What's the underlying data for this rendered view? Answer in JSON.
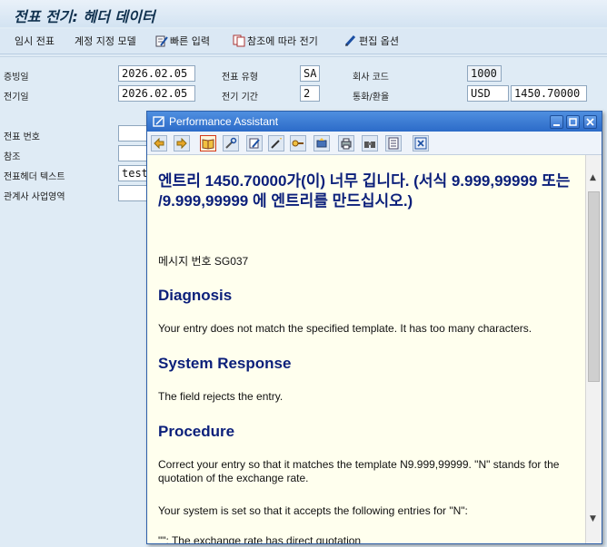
{
  "window": {
    "title": "전표 전기: 헤더 데이터"
  },
  "toolbar": {
    "items": [
      "임시 전표",
      "계정 지정 모델",
      "빠른 입력",
      "참조에 따라 전기",
      "편집 옵션"
    ]
  },
  "header_fields": {
    "doc_date_label": "증빙일",
    "doc_date_value": "2026.02.05",
    "post_date_label": "전기일",
    "post_date_value": "2026.02.05",
    "doc_type_label": "전표 유형",
    "doc_type_value": "SA",
    "period_label": "전기 기간",
    "period_value": "2",
    "company_label": "회사 코드",
    "company_value": "1000",
    "currency_label": "통화/환율",
    "currency_value": "USD",
    "rate_value": "1450.70000",
    "doc_number_label": "전표 번호",
    "reference_label": "참조",
    "header_text_label": "전표헤더 텍스트",
    "header_text_value": "test",
    "trading_partner_label": "관계사 사업영역"
  },
  "popup": {
    "title": "Performance Assistant",
    "heading": "엔트리 1450.70000가(이) 너무 깁니다. (서식 9.999,99999 또는 /9.999,99999 에 엔트리를 만드십시오.)",
    "message_number": "메시지 번호 SG037",
    "diagnosis_title": "Diagnosis",
    "diagnosis_text": "Your entry does not match the specified template. It has too many characters.",
    "response_title": "System Response",
    "response_text": "The field rejects the entry.",
    "procedure_title": "Procedure",
    "procedure_text1": "Correct your entry so that it matches the template N9.999,99999. \"N\" stands for the quotation of the exchange rate.",
    "procedure_text2": "Your system is set so that it accepts the following entries for \"N\":",
    "procedure_text3": "\"\": The exchange rate has direct quotation"
  }
}
